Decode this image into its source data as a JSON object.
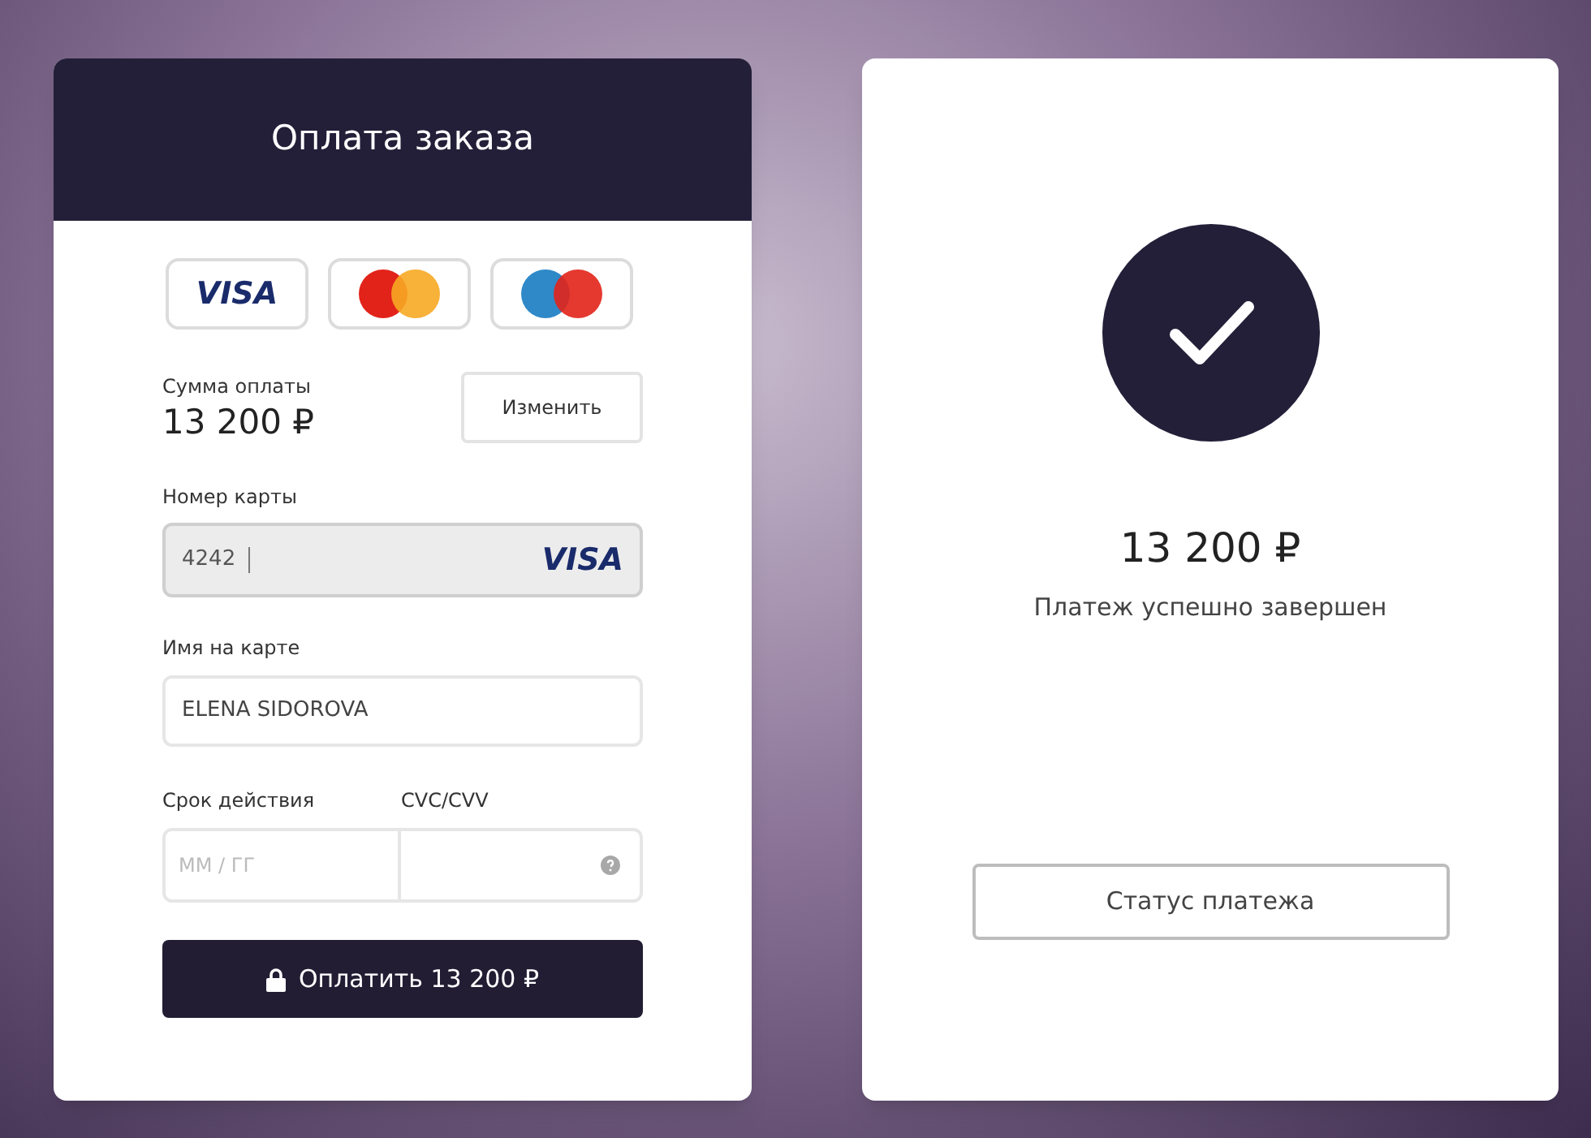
{
  "payment_form": {
    "title": "Оплата заказа",
    "card_brands": [
      {
        "kind": "visa",
        "label": "VISA"
      },
      {
        "kind": "mastercard"
      },
      {
        "kind": "maestro"
      }
    ],
    "amount": {
      "label": "Сумма оплаты",
      "value": "13 200 ₽",
      "change_button": "Изменить"
    },
    "card_number": {
      "label": "Номер карты",
      "value": "4242",
      "brand": "VISA"
    },
    "card_name": {
      "label": "Имя на карте",
      "value": "ELENA SIDOROVA"
    },
    "expiry": {
      "label": "Срок действия",
      "placeholder": "ММ / ГГ"
    },
    "cvc": {
      "label": "CVC/CVV"
    },
    "pay_button": "Оплатить 13 200 ₽"
  },
  "result": {
    "amount": "13 200 ₽",
    "message": "Платеж успешно завершен",
    "status_button": "Статус платежа"
  }
}
